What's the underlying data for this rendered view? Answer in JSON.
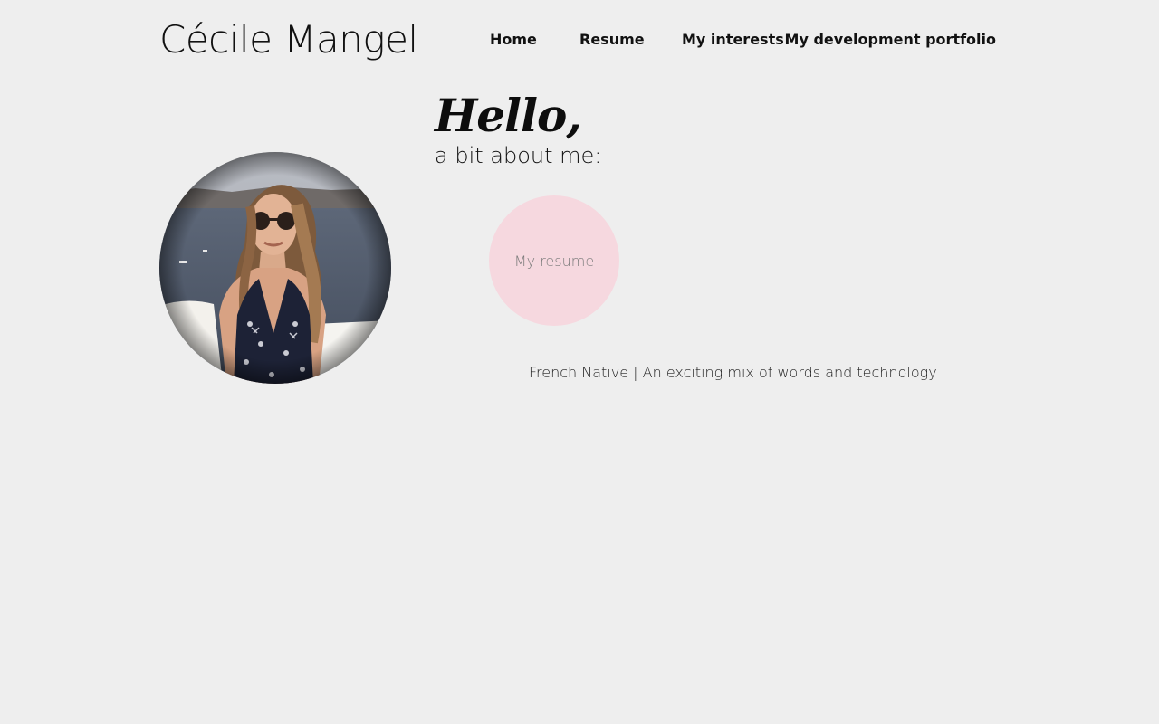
{
  "header": {
    "site_title": "Cécile Mangel",
    "nav": [
      {
        "label": "Home"
      },
      {
        "label": "Resume"
      },
      {
        "label": "My interests"
      },
      {
        "label": "My development portfolio"
      }
    ]
  },
  "main": {
    "heading": "Hello,",
    "subheading": "a bit about me:",
    "resume_button": "My resume",
    "tagline": "French Native | An exciting mix of words and technology"
  },
  "colors": {
    "background": "#eeeeee",
    "resume_circle": "#f6d8df",
    "text": "#111111"
  },
  "icons": {
    "avatar": "profile-photo"
  }
}
